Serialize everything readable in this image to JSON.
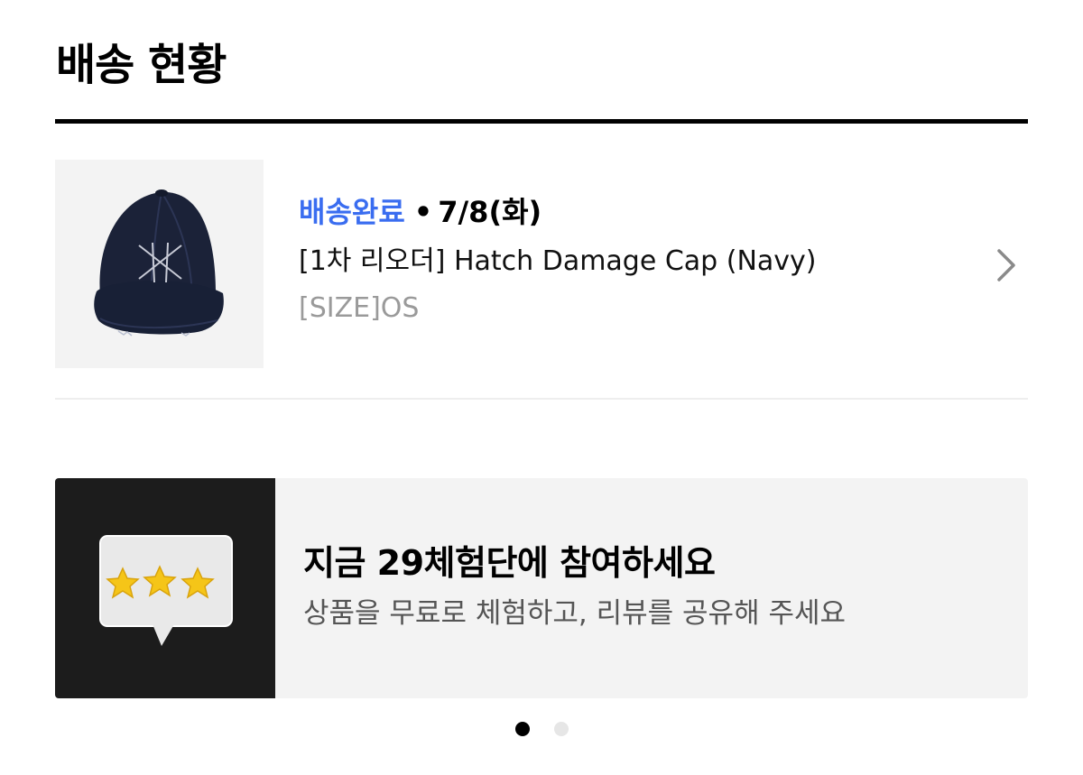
{
  "header": {
    "title": "배송 현황"
  },
  "order": {
    "status": "배송완료",
    "separator": "•",
    "date": "7/8(화)",
    "product_name": "[1차 리오더] Hatch Damage Cap (Navy)",
    "option": "[SIZE]OS",
    "thumbnail_icon": "navy-cap-image",
    "chevron_icon": "chevron-right-icon"
  },
  "banner": {
    "title": "지금 29체험단에 참여하세요",
    "subtitle": "상품을 무료로 체험하고, 리뷰를 공유해 주세요",
    "image_icon": "review-stars-bubble-icon"
  },
  "carousel": {
    "active_index": 1,
    "total": 2
  },
  "colors": {
    "status_blue": "#3a6df0",
    "banner_bg": "#f3f3f3",
    "banner_image_bg": "#1c1c1c",
    "star_yellow": "#f5c518",
    "cap_navy": "#1b2238"
  }
}
